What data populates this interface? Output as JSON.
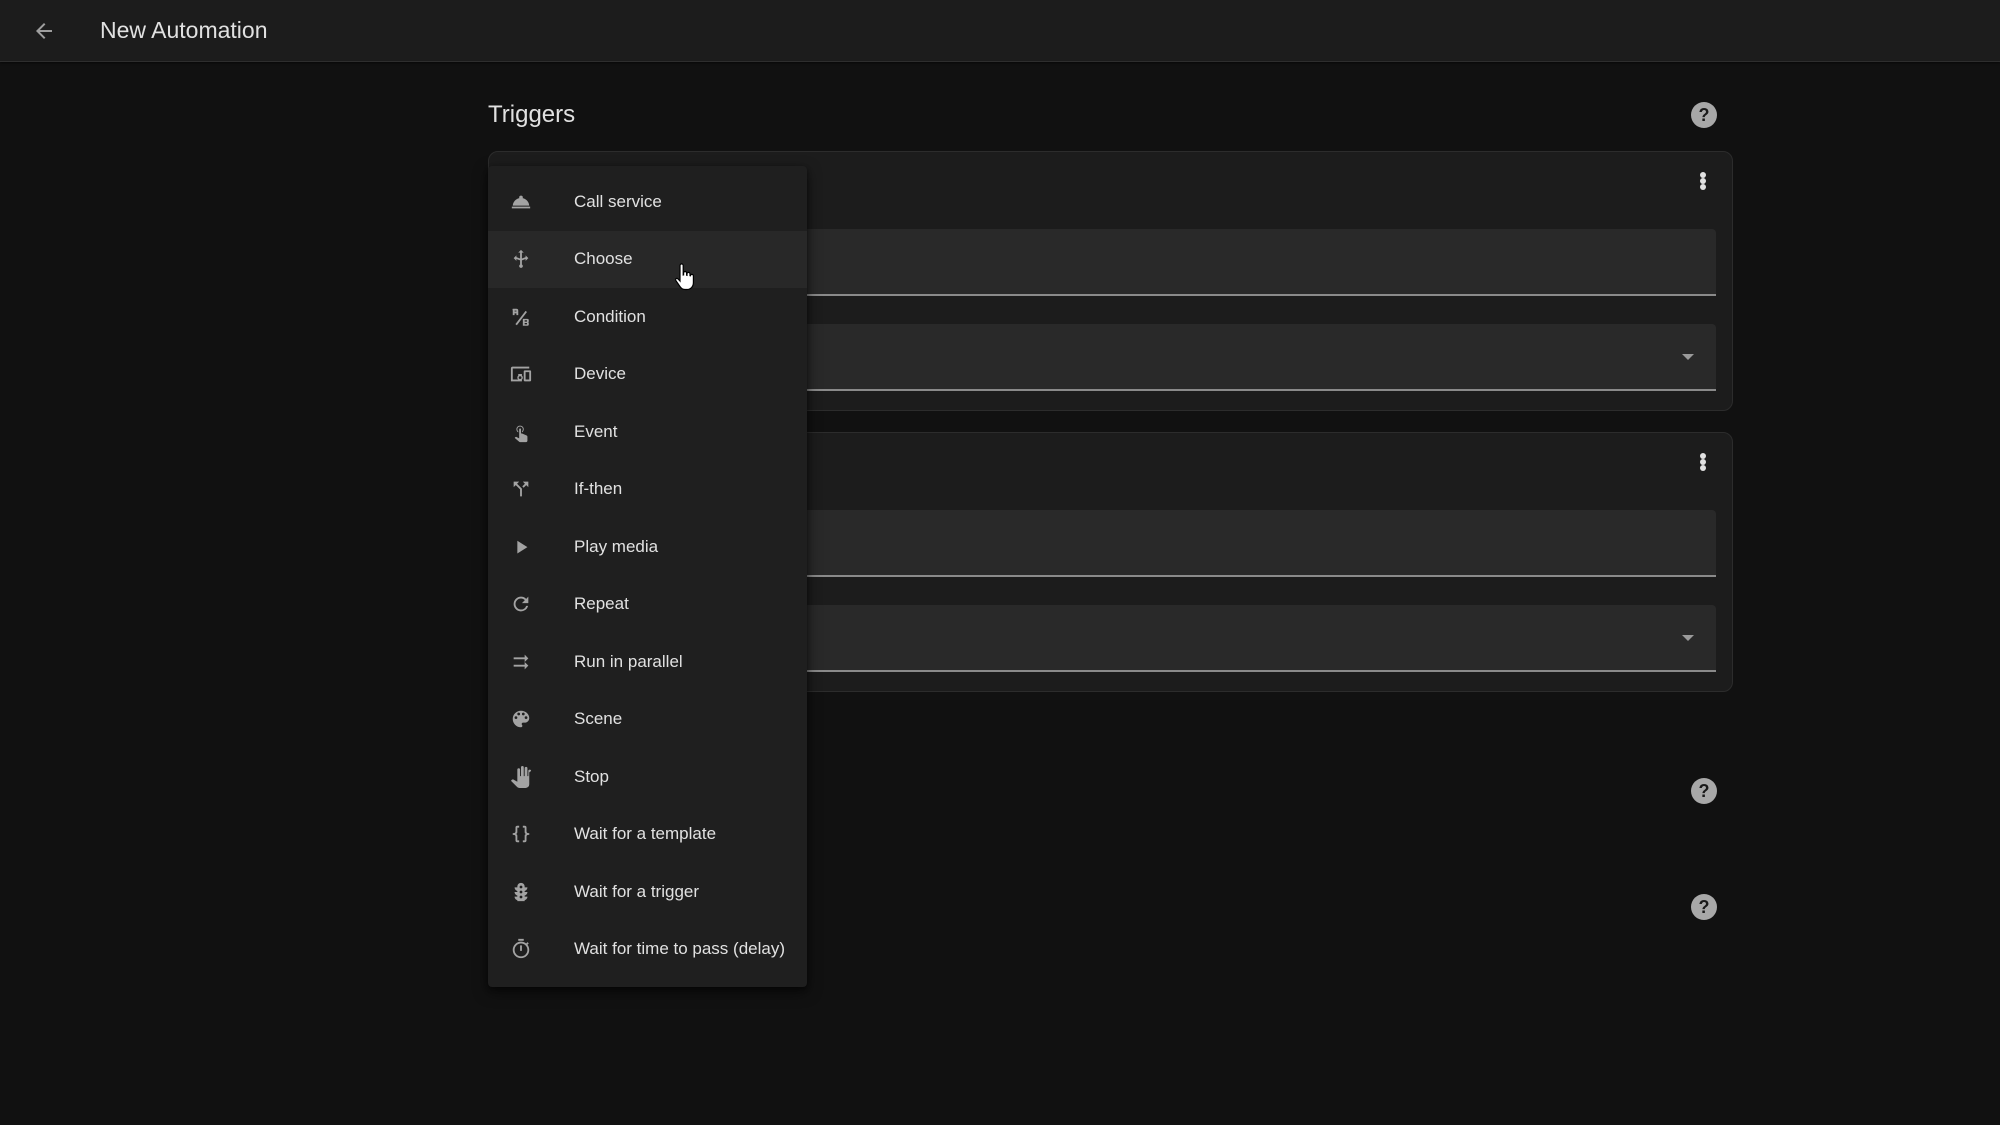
{
  "header": {
    "back_icon": "arrow-left-icon",
    "title": "New Automation"
  },
  "sections": [
    {
      "title": "Triggers",
      "help_icon": "help-circle-icon"
    },
    {
      "help_icon": "help-circle-icon"
    },
    {
      "help_icon": "help-circle-icon"
    }
  ],
  "cards": [
    {
      "menu_icon": "dots-vertical-icon",
      "fields": [
        {
          "value": ""
        },
        {
          "value": "",
          "dropdown_icon": "menu-down-icon"
        }
      ]
    },
    {
      "menu_icon": "dots-vertical-icon",
      "fields": [
        {
          "value": ""
        },
        {
          "value": "",
          "dropdown_icon": "menu-down-icon"
        }
      ]
    }
  ],
  "action_menu": {
    "hovered_item": "Choose",
    "items": [
      {
        "label": "Call service",
        "icon": "room-service-icon"
      },
      {
        "label": "Choose",
        "icon": "arrow-decision-icon"
      },
      {
        "label": "Condition",
        "icon": "ab-testing-icon"
      },
      {
        "label": "Device",
        "icon": "devices-icon"
      },
      {
        "label": "Event",
        "icon": "gesture-tap-icon"
      },
      {
        "label": "If-then",
        "icon": "call-split-icon"
      },
      {
        "label": "Play media",
        "icon": "play-icon"
      },
      {
        "label": "Repeat",
        "icon": "refresh-icon"
      },
      {
        "label": "Run in parallel",
        "icon": "shuffle-parallel-icon"
      },
      {
        "label": "Scene",
        "icon": "palette-icon"
      },
      {
        "label": "Stop",
        "icon": "hand-back-icon"
      },
      {
        "label": "Wait for a template",
        "icon": "code-braces-icon"
      },
      {
        "label": "Wait for a trigger",
        "icon": "traffic-light-icon"
      },
      {
        "label": "Wait for time to pass (delay)",
        "icon": "timer-outline-icon"
      }
    ]
  }
}
